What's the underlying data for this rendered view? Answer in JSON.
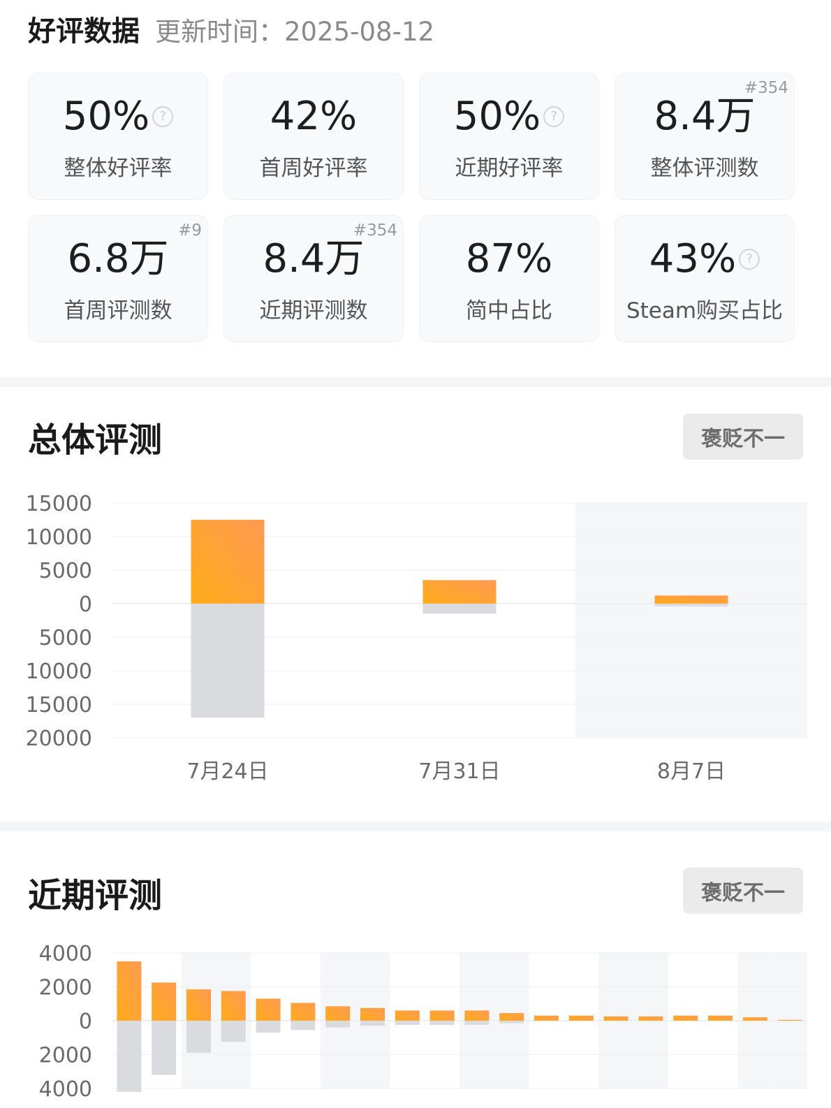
{
  "header": {
    "title": "好评数据",
    "update_label": "更新时间：",
    "update_date": "2025-08-12"
  },
  "stats": [
    {
      "value": "50%",
      "label": "整体好评率",
      "help": true
    },
    {
      "value": "42%",
      "label": "首周好评率"
    },
    {
      "value": "50%",
      "label": "近期好评率",
      "help": true
    },
    {
      "value": "8.4万",
      "label": "整体评测数",
      "rank": "#354"
    },
    {
      "value": "6.8万",
      "label": "首周评测数",
      "rank": "#9"
    },
    {
      "value": "8.4万",
      "label": "近期评测数",
      "rank": "#354"
    },
    {
      "value": "87%",
      "label": "简中占比"
    },
    {
      "value": "43%",
      "label": "Steam购买占比",
      "help": true
    }
  ],
  "overall": {
    "title": "总体评测",
    "tag": "褒贬不一"
  },
  "recent": {
    "title": "近期评测",
    "tag": "褒贬不一"
  },
  "colors": {
    "positive_top": "#ff9a52",
    "positive_bottom": "#ffab1a",
    "negative": "#d9dbdf",
    "band": "#f5f6f8"
  },
  "chart_data": [
    {
      "type": "bar",
      "title": "总体评测",
      "categories": [
        "7月24日",
        "7月31日",
        "8月7日"
      ],
      "y_ticks_above": [
        "15000",
        "10000",
        "5000",
        "0"
      ],
      "y_ticks_below": [
        "5000",
        "10000",
        "15000",
        "20000"
      ],
      "ylim": [
        -20000,
        15000
      ],
      "series": [
        {
          "values": [
            12500,
            3500,
            1200
          ]
        },
        {
          "values": [
            -17000,
            -1500,
            -400
          ]
        }
      ]
    },
    {
      "type": "bar",
      "title": "近期评测",
      "y_ticks_above": [
        "4000",
        "2000",
        "0"
      ],
      "y_ticks_below": [
        "2000",
        "4000"
      ],
      "ylim": [
        -4000,
        4000
      ],
      "series": [
        {
          "values": [
            3500,
            2250,
            1850,
            1750,
            1300,
            1050,
            850,
            750,
            600,
            600,
            600,
            450,
            300,
            300,
            250,
            250,
            300,
            300,
            200,
            50
          ]
        },
        {
          "values": [
            -4200,
            -3200,
            -1900,
            -1250,
            -700,
            -550,
            -400,
            -300,
            -250,
            -250,
            -250,
            -150,
            0,
            0,
            0,
            0,
            0,
            0,
            0,
            0
          ]
        }
      ]
    }
  ]
}
